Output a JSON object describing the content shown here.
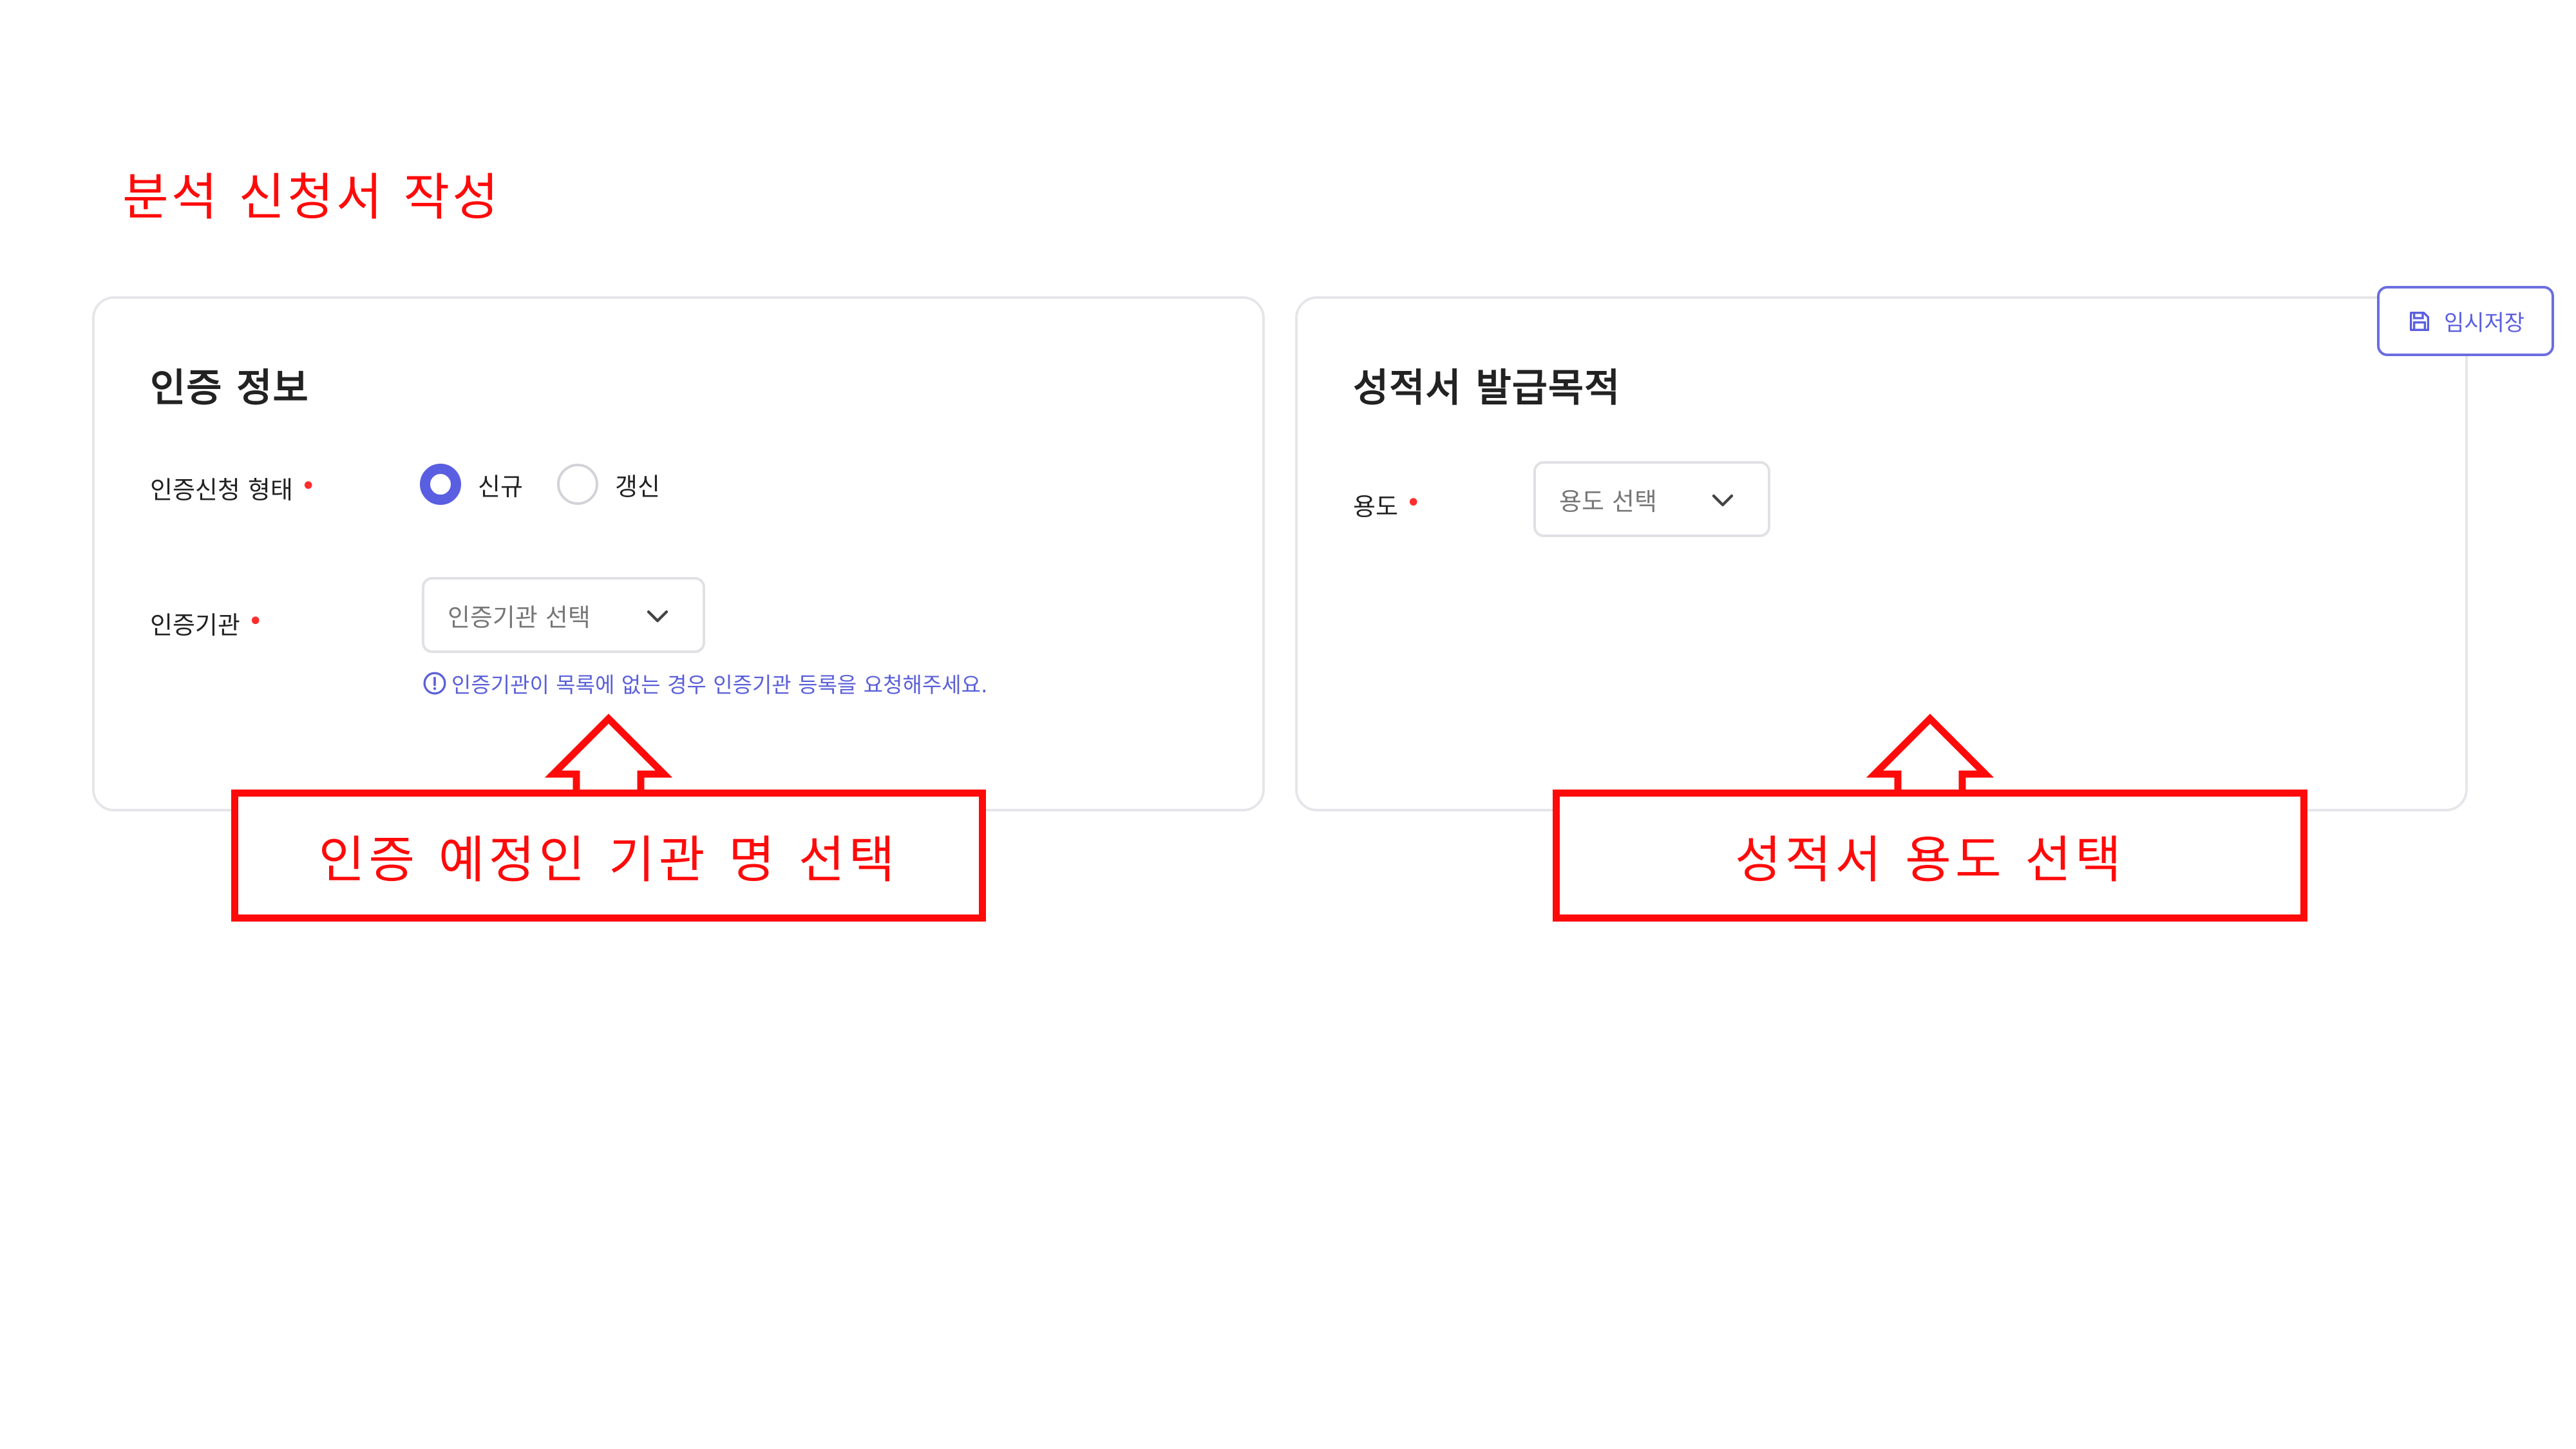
{
  "page": {
    "title": "분석 신청서 작성"
  },
  "cert_card": {
    "title": "인증 정보",
    "type_field": {
      "label": "인증신청 형태",
      "required_mark": "•",
      "options": [
        {
          "label": "신규",
          "selected": true
        },
        {
          "label": "갱신",
          "selected": false
        }
      ]
    },
    "agency_field": {
      "label": "인증기관",
      "required_mark": "•",
      "placeholder": "인증기관 선택",
      "notice": "인증기관이 목록에 없는 경우 인증기관 등록을 요청해주세요."
    }
  },
  "purpose_card": {
    "title": "성적서 발급목적",
    "usage_field": {
      "label": "용도",
      "required_mark": "•",
      "placeholder": "용도 선택"
    }
  },
  "toolbar": {
    "save_label": "임시저장"
  },
  "annotations": {
    "left_callout": "인증 예정인 기관 명 선택",
    "right_callout": "성적서 용도 선택"
  },
  "colors": {
    "accent": "#5a5ee0",
    "annotation": "#ff0a0a",
    "required": "#ff2d2d",
    "card_border": "#e6e6ea"
  },
  "icons": {
    "save": "save-icon",
    "notice": "info-circle-icon",
    "dropdown": "chevron-down-icon"
  }
}
